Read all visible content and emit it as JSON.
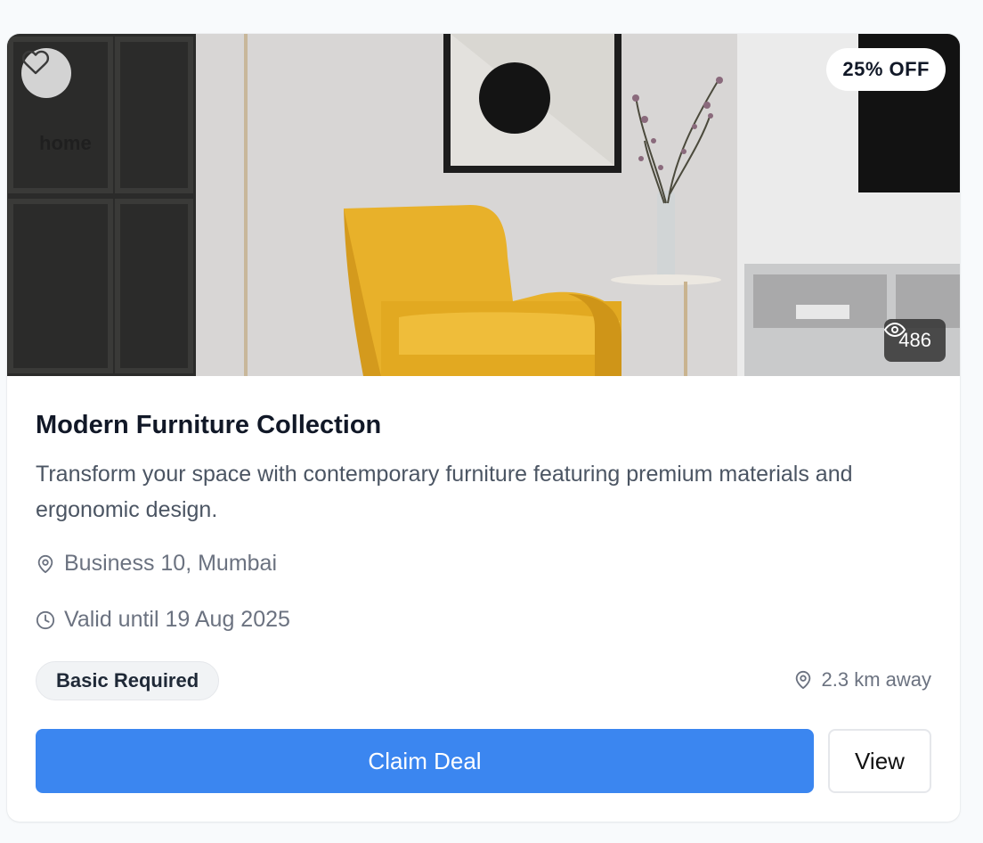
{
  "deal": {
    "category": "home",
    "discount": "25% OFF",
    "views": "486",
    "title": "Modern Furniture Collection",
    "description": "Transform your space with contemporary furniture featuring premium materials and ergonomic design.",
    "location": "Business 10, Mumbai",
    "valid_until": "Valid until 19 Aug 2025",
    "tier_badge": "Basic Required",
    "distance": "2.3 km away"
  },
  "actions": {
    "claim_label": "Claim Deal",
    "view_label": "View"
  },
  "icons": {
    "favorite": "heart-icon",
    "views": "eye-icon",
    "location": "map-pin-icon",
    "time": "clock-icon",
    "distance": "map-pin-icon"
  },
  "colors": {
    "primary": "#3b86f0",
    "text_dark": "#111827",
    "text_muted": "#6b7280"
  }
}
